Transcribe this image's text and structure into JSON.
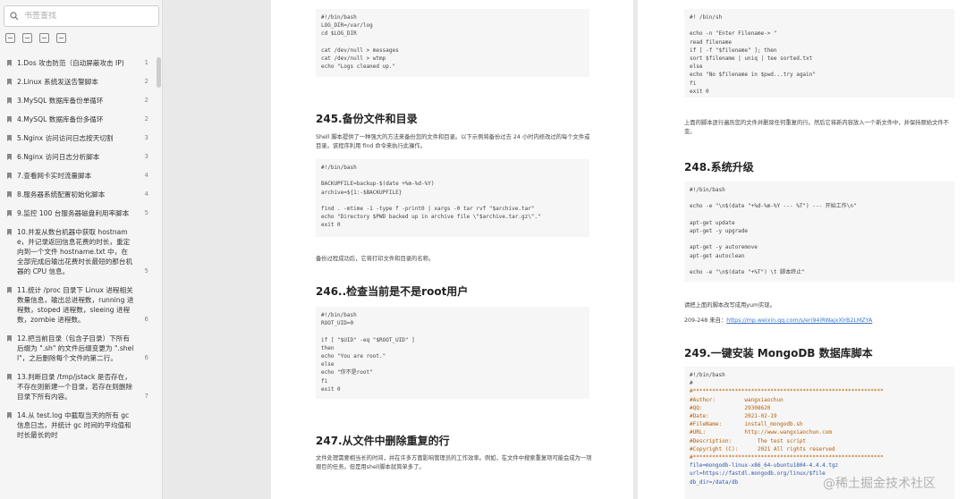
{
  "sidebar": {
    "search_placeholder": "书签查找",
    "items": [
      {
        "title": "1.Dos 攻击防范（自动屏蔽攻击 IP)",
        "page": "1"
      },
      {
        "title": "2.Linux 系统发送告警脚本",
        "page": "2"
      },
      {
        "title": "3.MySQL 数据库备份单循环",
        "page": "2"
      },
      {
        "title": "4.MySQL 数据库备份多循环",
        "page": "2"
      },
      {
        "title": "5.Nginx 访问访问日志按天切割",
        "page": "3"
      },
      {
        "title": "6.Nginx 访问日志分析脚本",
        "page": "3"
      },
      {
        "title": "7.查看网卡实时流量脚本",
        "page": "4"
      },
      {
        "title": "8.服务器系统配置初始化脚本",
        "page": "4"
      },
      {
        "title": "9.监控 100 台服务器磁盘利用率脚本",
        "page": "5"
      },
      {
        "title": "10.并发从数台机器中获取 hostname，并记录返回信息花费的时长，重定向到一个文件 hostname.txt 中，在全部完成后输出花费时长最短的那台机器的 CPU 信息。",
        "page": "5"
      },
      {
        "title": "11.统计 /proc 目录下 Linux 进程相关数量信息，输出总进程数，running 进程数，stoped 进程数，sleeing 进程数，zombie 进程数。",
        "page": "6"
      },
      {
        "title": "12.把当前目录（包含子目录）下所有后缀为 \".sh\" 的文件后缀变更为 \".shell\"，之后删除每个文件的第二行。",
        "page": "6"
      },
      {
        "title": "13.判断目录 /tmp/jstack 是否存在，不存在则新建一个目录，若存在则删除目录下所有内容。",
        "page": "7"
      },
      {
        "title": "14.从 test.log 中截取当天的所有 gc 信息日志，并统计 gc 时间的平均值和时长最长的时",
        "page": ""
      }
    ]
  },
  "page1": {
    "code1": [
      "#!/bin/bash",
      "LOG_DIR=/var/log",
      "cd $LOG_DIR",
      "",
      "cat /dev/null > messages",
      "cat /dev/null > wtmp",
      "echo \"Logs cleaned up.\""
    ],
    "h245": "245.备份文件和目录",
    "p245": "Shell 脚本提供了一种强大的方法来备份您的文件和目录。以下示例将备份过去 24 小时内修改过的每个文件或目录。该程序利用 find 命令来执行此操作。",
    "code2": [
      "#!/bin/bash",
      "",
      "BACKUPFILE=backup-$(date +%m-%d-%Y)",
      "archive=${1:-$BACKUPFILE}",
      "",
      "find . -mtime -1 -type f -print0 | xargs -0 tar rvf \"$archive.tar\"",
      "echo \"Directory $PWD backed up in archive file \\\"$archive.tar.gz\\\".\"",
      "exit 0"
    ],
    "p245b": "备份过程成功后，它将打印文件和目录的名称。",
    "h246": "246..检查当前是不是root用户",
    "code3": [
      "#!/bin/bash",
      "ROOT_UID=0",
      "",
      "if [ \"$UID\" -eq \"$ROOT_UID\" ]",
      "then",
      "echo \"You are root.\"",
      "else",
      "echo \"你不是root\"",
      "fi",
      "exit 0"
    ],
    "h247": "247.从文件中删除重复的行",
    "p247": "文件处理需要相当长的时间，并在许多方面影响管理员的工作效率。例如，在文件中搜索重复项可能会成为一项艰巨的任务。但是用shell脚本就简单多了。"
  },
  "page2": {
    "code1": [
      "#! /bin/sh",
      "",
      "echo -n \"Enter Filename-> \"",
      "read filename",
      "if [ -f \"$filename\" ]; then",
      "sort $filename | uniq | tee sorted.txt",
      "else",
      "echo \"No $filename in $pwd...try again\"",
      "fi",
      "exit 0"
    ],
    "p1": "上面的脚本逐行遍历您的文件并删除任何重复的行。然后它将新内容放入一个新文件中，并保持原始文件不变。",
    "h248": "248.系统升级",
    "code2": [
      "#!/bin/bash",
      "",
      "echo -e \"\\n$(date \"+%d-%m-%Y --- %T\") --- 开始工作\\n\"",
      "",
      "apt-get update",
      "apt-get -y upgrade",
      "",
      "apt-get -y autoremove",
      "apt-get autoclean",
      "",
      "echo -e \"\\n$(date \"+%T\") \\t 脚本终止\""
    ],
    "p2": "请把上面的脚本改写成用yum实现。",
    "p3_prefix": "209-248 来自：",
    "p3_link": "https://mp.weixin.qq.com/s/eri94iRWajxXlrB2LMZYA",
    "h249": "249.一键安装 MongoDB 数据库脚本",
    "code3_head": [
      "#!/bin/bash",
      "#"
    ],
    "code3_comments": [
      "#***********************************************************",
      "#Author:         wangxiaochun",
      "#QQ:             29308620",
      "#Date:           2021-02-19",
      "#FileName:       install_mongodb.sh",
      "#URL:            http://www.wangxiaochun.com",
      "#Description:        The test script",
      "#Copyright (C):      2021 All rights reserved",
      "#***********************************************************"
    ],
    "code3_tail": [
      "file=mongodb-linux-x86_64-ubuntu1804-4.4.4.tgz",
      "url=https://fastdl.mongodb.org/linux/$file",
      "db_dir=/data/db"
    ]
  },
  "watermark": "@稀土掘金技术社区"
}
